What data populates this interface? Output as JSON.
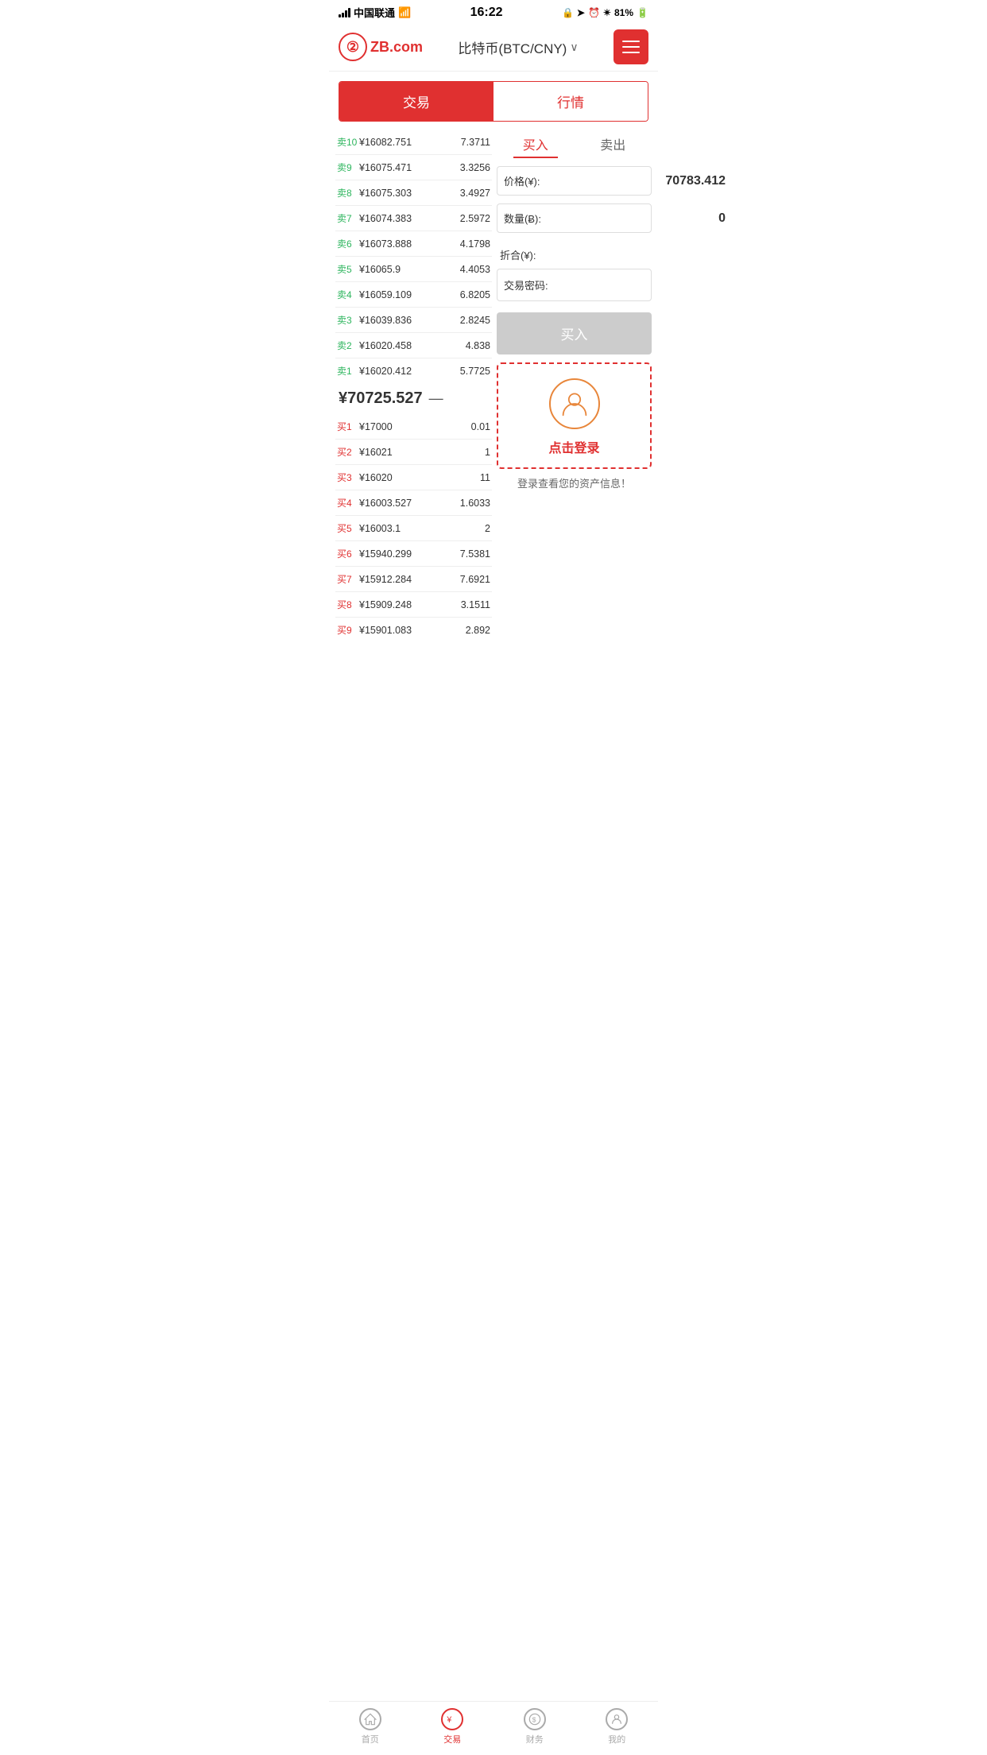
{
  "statusBar": {
    "carrier": "中国联通",
    "time": "16:22",
    "battery": "81%"
  },
  "header": {
    "logoText": "ZB.com",
    "title": "比特币(BTC/CNY)",
    "menuAria": "menu"
  },
  "tabs": [
    {
      "id": "trade",
      "label": "交易",
      "active": true
    },
    {
      "id": "market",
      "label": "行情",
      "active": false
    }
  ],
  "orderBook": {
    "sells": [
      {
        "label": "卖10",
        "price": "¥16082.751",
        "qty": "7.3711"
      },
      {
        "label": "卖9",
        "price": "¥16075.471",
        "qty": "3.3256"
      },
      {
        "label": "卖8",
        "price": "¥16075.303",
        "qty": "3.4927"
      },
      {
        "label": "卖7",
        "price": "¥16074.383",
        "qty": "2.5972"
      },
      {
        "label": "卖6",
        "price": "¥16073.888",
        "qty": "4.1798"
      },
      {
        "label": "卖5",
        "price": "¥16065.9",
        "qty": "4.4053"
      },
      {
        "label": "卖4",
        "price": "¥16059.109",
        "qty": "6.8205"
      },
      {
        "label": "卖3",
        "price": "¥16039.836",
        "qty": "2.8245"
      },
      {
        "label": "卖2",
        "price": "¥16020.458",
        "qty": "4.838"
      },
      {
        "label": "卖1",
        "price": "¥16020.412",
        "qty": "5.7725"
      }
    ],
    "currentPrice": "¥70725.527",
    "priceIndicator": "—",
    "buys": [
      {
        "label": "买1",
        "price": "¥17000",
        "qty": "0.01"
      },
      {
        "label": "买2",
        "price": "¥16021",
        "qty": "1"
      },
      {
        "label": "买3",
        "price": "¥16020",
        "qty": "11"
      },
      {
        "label": "买4",
        "price": "¥16003.527",
        "qty": "1.6033"
      },
      {
        "label": "买5",
        "price": "¥16003.1",
        "qty": "2"
      },
      {
        "label": "买6",
        "price": "¥15940.299",
        "qty": "7.5381"
      },
      {
        "label": "买7",
        "price": "¥15912.284",
        "qty": "7.6921"
      },
      {
        "label": "买8",
        "price": "¥15909.248",
        "qty": "3.1511"
      },
      {
        "label": "买9",
        "price": "¥15901.083",
        "qty": "2.892"
      }
    ]
  },
  "tradePanel": {
    "buyTab": "买入",
    "sellTab": "卖出",
    "priceLabel": "价格(¥):",
    "priceValue": "70783.412",
    "qtyLabel": "数量(Ƀ):",
    "qtyValue": "0",
    "totalLabel": "折合(¥):",
    "totalValue": "",
    "passwordLabel": "交易密码:",
    "passwordValue": "",
    "buyBtnLabel": "买入"
  },
  "loginPrompt": {
    "loginText": "点击登录",
    "assetInfo": "登录查看您的资产信息！"
  },
  "bottomNav": [
    {
      "id": "home",
      "label": "首页",
      "icon": "star",
      "active": false
    },
    {
      "id": "trade",
      "label": "交易",
      "icon": "yen",
      "active": true
    },
    {
      "id": "finance",
      "label": "财务",
      "icon": "money",
      "active": false
    },
    {
      "id": "mine",
      "label": "我的",
      "icon": "person",
      "active": false
    }
  ]
}
